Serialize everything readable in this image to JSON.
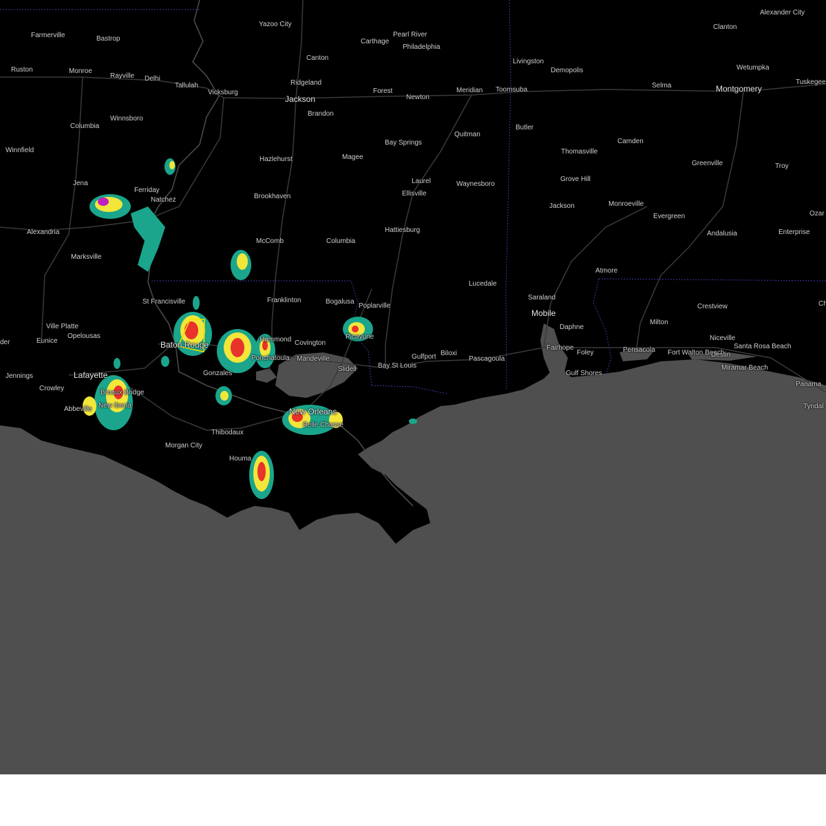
{
  "map": {
    "colors": {
      "land": "#000000",
      "water": "#4f4f4f",
      "roads": "#3a3a3a",
      "state_border": "#3a3aa8",
      "warning_polygon": "#f0e000",
      "radar_light": "#1aa58c",
      "radar_mid": "#f2e63a",
      "radar_heavy": "#e8332a",
      "radar_extreme": "#c020c0"
    },
    "labels": [
      {
        "id": "yazoo-city",
        "text": "Yazoo City"
      },
      {
        "id": "farmerville",
        "text": "Farmerville"
      },
      {
        "id": "bastrop",
        "text": "Bastrop"
      },
      {
        "id": "carthage",
        "text": "Carthage"
      },
      {
        "id": "pearl-river",
        "text": "Pearl River"
      },
      {
        "id": "philadelphia",
        "text": "Philadelphia"
      },
      {
        "id": "clanton",
        "text": "Clanton"
      },
      {
        "id": "alexander-city",
        "text": "Alexander City"
      },
      {
        "id": "canton",
        "text": "Canton"
      },
      {
        "id": "livingston",
        "text": "Livingston"
      },
      {
        "id": "ruston",
        "text": "Ruston"
      },
      {
        "id": "monroe",
        "text": "Monroe"
      },
      {
        "id": "rayville",
        "text": "Rayville"
      },
      {
        "id": "delhi",
        "text": "Delhi"
      },
      {
        "id": "tallulah",
        "text": "Tallulah"
      },
      {
        "id": "ridgeland",
        "text": "Ridgeland"
      },
      {
        "id": "demopolis",
        "text": "Demopolis"
      },
      {
        "id": "wetumpka",
        "text": "Wetumpka"
      },
      {
        "id": "vicksburg",
        "text": "Vicksburg"
      },
      {
        "id": "jackson",
        "text": "Jackson"
      },
      {
        "id": "forest",
        "text": "Forest"
      },
      {
        "id": "meridian",
        "text": "Meridian"
      },
      {
        "id": "toomsuba",
        "text": "Toomsuba"
      },
      {
        "id": "newton",
        "text": "Newton"
      },
      {
        "id": "selma",
        "text": "Selma"
      },
      {
        "id": "montgomery",
        "text": "Montgomery"
      },
      {
        "id": "tuskegee",
        "text": "Tuskegee"
      },
      {
        "id": "brandon",
        "text": "Brandon"
      },
      {
        "id": "winnsboro",
        "text": "Winnsboro"
      },
      {
        "id": "columbia-la",
        "text": "Columbia"
      },
      {
        "id": "butler",
        "text": "Butler"
      },
      {
        "id": "quitman",
        "text": "Quitman"
      },
      {
        "id": "bay-springs",
        "text": "Bay Springs"
      },
      {
        "id": "thomasville",
        "text": "Thomasville"
      },
      {
        "id": "camden",
        "text": "Camden"
      },
      {
        "id": "winnfield",
        "text": "Winnfield"
      },
      {
        "id": "hazlehurst",
        "text": "Hazlehurst"
      },
      {
        "id": "magee",
        "text": "Magee"
      },
      {
        "id": "greenville",
        "text": "Greenville"
      },
      {
        "id": "troy",
        "text": "Troy"
      },
      {
        "id": "grove-hill",
        "text": "Grove Hill"
      },
      {
        "id": "jena",
        "text": "Jena"
      },
      {
        "id": "laurel",
        "text": "Laurel"
      },
      {
        "id": "waynesboro",
        "text": "Waynesboro"
      },
      {
        "id": "ferriday",
        "text": "Ferriday"
      },
      {
        "id": "ellisville",
        "text": "Ellisville"
      },
      {
        "id": "brookhaven",
        "text": "Brookhaven"
      },
      {
        "id": "natchez",
        "text": "Natchez"
      },
      {
        "id": "jackson-al",
        "text": "Jackson"
      },
      {
        "id": "monroeville",
        "text": "Monroeville"
      },
      {
        "id": "evergreen",
        "text": "Evergreen"
      },
      {
        "id": "ozark",
        "text": "Ozar"
      },
      {
        "id": "hattiesburg",
        "text": "Hattiesburg"
      },
      {
        "id": "alexandria",
        "text": "Alexandria"
      },
      {
        "id": "andalusia",
        "text": "Andalusia"
      },
      {
        "id": "enterprise",
        "text": "Enterprise"
      },
      {
        "id": "mccomb",
        "text": "McComb"
      },
      {
        "id": "columbia-ms",
        "text": "Columbia"
      },
      {
        "id": "marksville",
        "text": "Marksville"
      },
      {
        "id": "atmore",
        "text": "Atmore"
      },
      {
        "id": "lucedale",
        "text": "Lucedale"
      },
      {
        "id": "saraland",
        "text": "Saraland"
      },
      {
        "id": "st-francisville",
        "text": "St Francisville"
      },
      {
        "id": "franklinton",
        "text": "Franklinton"
      },
      {
        "id": "bogalusa",
        "text": "Bogalusa"
      },
      {
        "id": "poplarville",
        "text": "Poplarville"
      },
      {
        "id": "crestview",
        "text": "Crestview"
      },
      {
        "id": "mobile",
        "text": "Mobile"
      },
      {
        "id": "ville-platte",
        "text": "Ville Platte"
      },
      {
        "id": "milton",
        "text": "Milton"
      },
      {
        "id": "daphne",
        "text": "Daphne"
      },
      {
        "id": "opelousas",
        "text": "Opelousas"
      },
      {
        "id": "niceville",
        "text": "Niceville"
      },
      {
        "id": "eunice",
        "text": "Eunice"
      },
      {
        "id": "baton-rouge",
        "text": "Baton Rouge"
      },
      {
        "id": "hammond",
        "text": "Hammond"
      },
      {
        "id": "covington",
        "text": "Covington"
      },
      {
        "id": "picayune",
        "text": "Picayune"
      },
      {
        "id": "santa-rosa-beach",
        "text": "Santa Rosa Beach"
      },
      {
        "id": "fairhope",
        "text": "Fairhope"
      },
      {
        "id": "pensacola",
        "text": "Pensacola"
      },
      {
        "id": "fort-walton-beach",
        "text": "Fort Walton Beach"
      },
      {
        "id": "destin",
        "text": "Destin"
      },
      {
        "id": "foley",
        "text": "Foley"
      },
      {
        "id": "biloxi",
        "text": "Biloxi"
      },
      {
        "id": "gulfport",
        "text": "Gulfport"
      },
      {
        "id": "pascagoula",
        "text": "Pascagoula"
      },
      {
        "id": "ponchatoula",
        "text": "Ponchatoula"
      },
      {
        "id": "mandeville",
        "text": "Mandeville"
      },
      {
        "id": "bay-st-louis",
        "text": "Bay St Louis"
      },
      {
        "id": "jennings",
        "text": "Jennings"
      },
      {
        "id": "lafayette",
        "text": "Lafayette"
      },
      {
        "id": "slidell",
        "text": "Slidell"
      },
      {
        "id": "gonzales",
        "text": "Gonzales"
      },
      {
        "id": "gulf-shores",
        "text": "Gulf Shores"
      },
      {
        "id": "miramar-beach",
        "text": "Miramar Beach"
      },
      {
        "id": "panama",
        "text": "Panama"
      },
      {
        "id": "crowley",
        "text": "Crowley"
      },
      {
        "id": "breaux-bridge",
        "text": "Breaux Bridge"
      },
      {
        "id": "abbeville",
        "text": "Abbeville"
      },
      {
        "id": "new-iberia",
        "text": "New Iberia"
      },
      {
        "id": "tyndall",
        "text": "Tyndal"
      },
      {
        "id": "new-orleans",
        "text": "New Orleans"
      },
      {
        "id": "belle-chasse",
        "text": "Belle Chasse"
      },
      {
        "id": "thibodaux",
        "text": "Thibodaux"
      },
      {
        "id": "morgan-city",
        "text": "Morgan City"
      },
      {
        "id": "houma",
        "text": "Houma"
      },
      {
        "id": "ch",
        "text": "Ch"
      },
      {
        "id": "der",
        "text": "der"
      }
    ]
  }
}
